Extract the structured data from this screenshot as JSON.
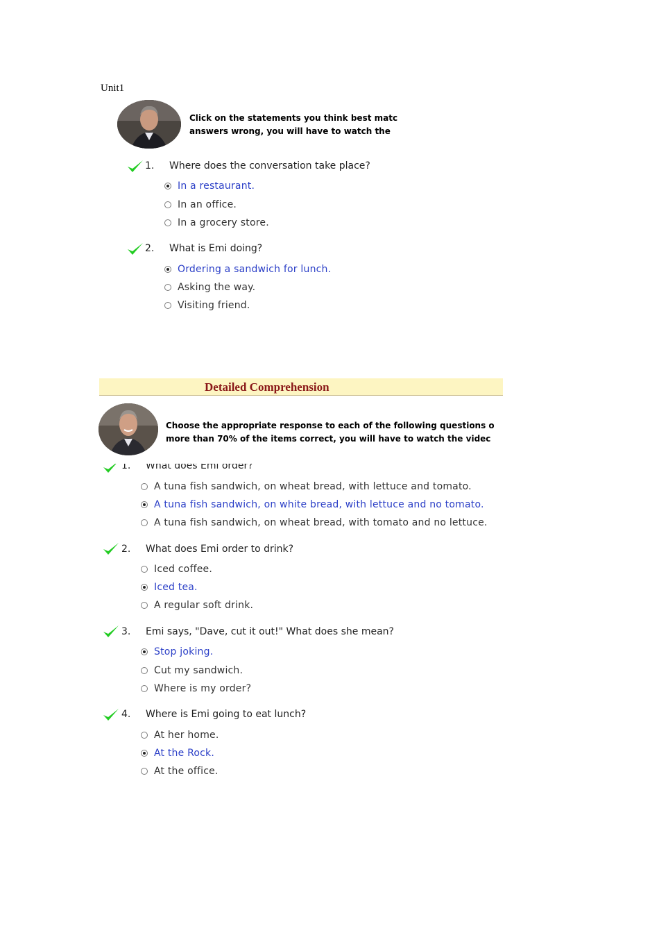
{
  "unit_label": "Unit1",
  "section1": {
    "instructions": [
      "Click on the statements you think best matc",
      "answers wrong, you will have to watch the"
    ],
    "questions": [
      {
        "number": "1.",
        "text": "Where does the conversation take place?",
        "correct": true,
        "options": [
          {
            "text": "In a restaurant.",
            "selected": true
          },
          {
            "text": "In an office.",
            "selected": false
          },
          {
            "text": "In a grocery store.",
            "selected": false
          }
        ]
      },
      {
        "number": "2.",
        "text": "What is Emi doing?",
        "correct": true,
        "options": [
          {
            "text": "Ordering a sandwich for lunch.",
            "selected": true
          },
          {
            "text": "Asking the way.",
            "selected": false
          },
          {
            "text": "Visiting friend.",
            "selected": false
          }
        ]
      }
    ]
  },
  "section2": {
    "title": "Detailed Comprehension",
    "instructions": [
      "Choose the appropriate response to each of the following questions o",
      "more than 70% of the items correct, you will have to watch the videc"
    ],
    "questions": [
      {
        "number": "1.",
        "text": "What does Emi order?",
        "correct": true,
        "options": [
          {
            "text": "A tuna fish sandwich, on wheat bread, with lettuce and tomato.",
            "selected": false
          },
          {
            "text": "A tuna fish sandwich, on white bread, with lettuce and no tomato.",
            "selected": true
          },
          {
            "text": "A tuna fish sandwich, on wheat bread, with tomato and no lettuce.",
            "selected": false
          }
        ]
      },
      {
        "number": "2.",
        "text": "What does Emi order to drink?",
        "correct": true,
        "options": [
          {
            "text": "Iced coffee.",
            "selected": false
          },
          {
            "text": "Iced tea.",
            "selected": true
          },
          {
            "text": "A regular soft drink.",
            "selected": false
          }
        ]
      },
      {
        "number": "3.",
        "text": "Emi says, \"Dave, cut it out!\" What does she mean?",
        "correct": true,
        "options": [
          {
            "text": "Stop joking.",
            "selected": true
          },
          {
            "text": "Cut my sandwich.",
            "selected": false
          },
          {
            "text": "Where is my order?",
            "selected": false
          }
        ]
      },
      {
        "number": "4.",
        "text": "Where is Emi going to eat lunch?",
        "correct": true,
        "options": [
          {
            "text": "At her home.",
            "selected": false
          },
          {
            "text": "At the Rock.",
            "selected": true
          },
          {
            "text": "At the office.",
            "selected": false
          }
        ]
      }
    ]
  },
  "colors": {
    "check": "#22cc22",
    "selected_text": "#2b3fc7",
    "banner_bg": "#fdf5c2",
    "banner_title": "#8a1818"
  },
  "icons": {
    "check": "check-icon",
    "avatar": "instructor-avatar",
    "radio": "radio-button"
  }
}
